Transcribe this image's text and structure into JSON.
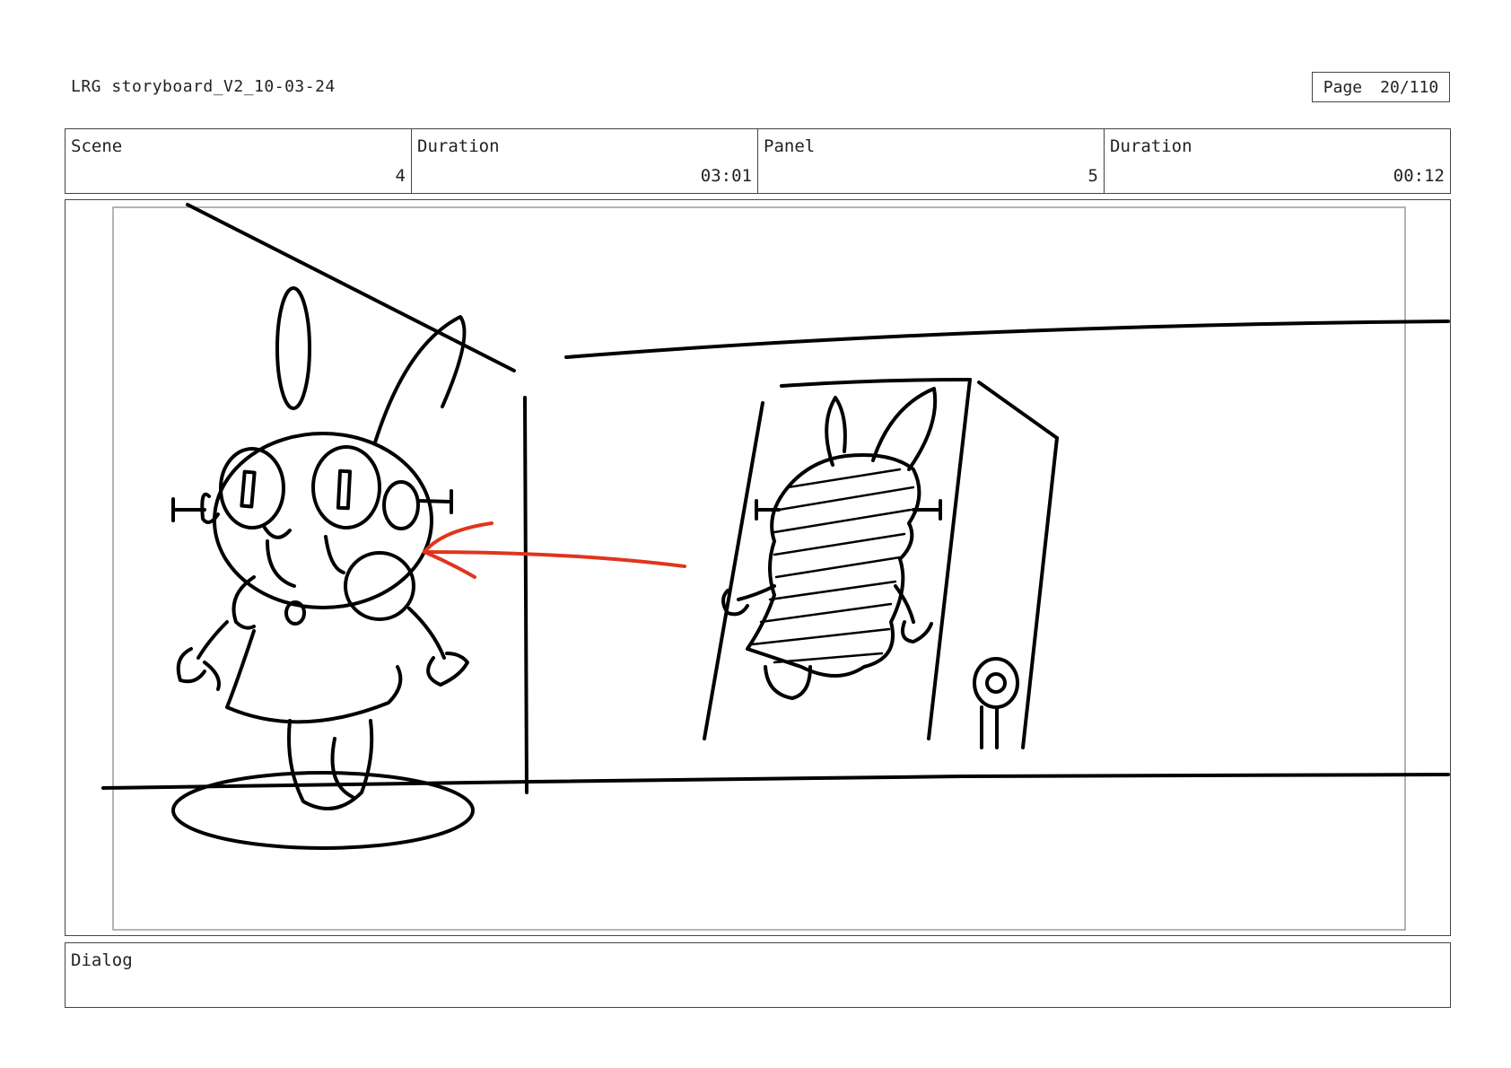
{
  "header": {
    "file_title": "LRG storyboard_V2_10-03-24",
    "page_label": "Page",
    "page_value": "20/110"
  },
  "info": {
    "scene_label": "Scene",
    "scene_value": "4",
    "scene_duration_label": "Duration",
    "scene_duration_value": "03:01",
    "panel_label": "Panel",
    "panel_value": "5",
    "panel_duration_label": "Duration",
    "panel_duration_value": "00:12"
  },
  "dialog": {
    "label": "Dialog",
    "text": ""
  },
  "colors": {
    "ink": "#000000",
    "arrow": "#e0351c",
    "frame": "#9a9a9a"
  }
}
